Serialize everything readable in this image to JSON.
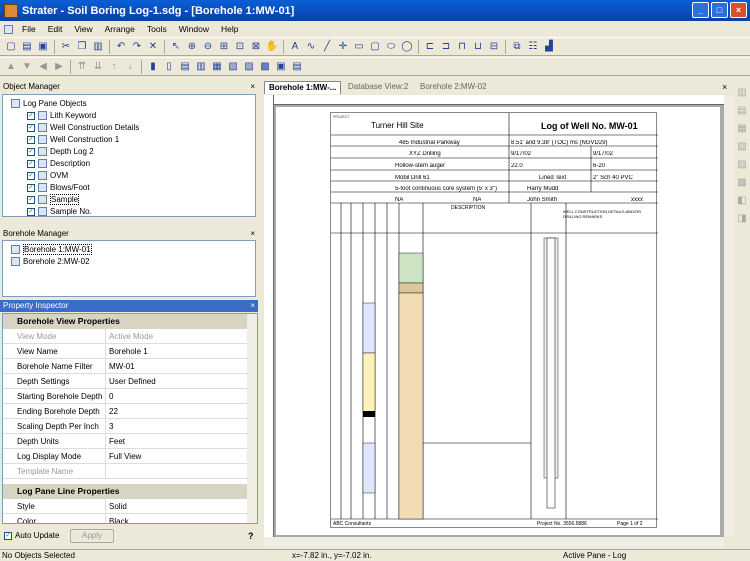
{
  "window": {
    "title": "Strater - Soil Boring Log-1.sdg - [Borehole 1:MW-01]",
    "min": "_",
    "max": "□",
    "close": "×"
  },
  "menu": [
    "File",
    "Edit",
    "View",
    "Arrange",
    "Tools",
    "Window",
    "Help"
  ],
  "object_manager": {
    "title": "Object Manager",
    "items": [
      "Log Pane Objects",
      "Lith Keyword",
      "Well Construction Details",
      "Well Construction 1",
      "Depth Log 2",
      "Description",
      "OVM",
      "Blows/Foot",
      "Sample",
      "Sample No."
    ]
  },
  "borehole_manager": {
    "title": "Borehole Manager",
    "items": [
      "Borehole 1:MW-01",
      "Borehole 2:MW-02"
    ]
  },
  "property_inspector": {
    "title": "Property Inspector",
    "section1": "Borehole View Properties",
    "rows": [
      {
        "k": "View Mode",
        "v": "Active Mode",
        "dim": true
      },
      {
        "k": "View Name",
        "v": "Borehole 1"
      },
      {
        "k": "Borehole Name Filter",
        "v": "MW-01"
      },
      {
        "k": "Depth Settings",
        "v": "User Defined"
      },
      {
        "k": "Starting Borehole Depth",
        "v": "0"
      },
      {
        "k": "Ending Borehole Depth",
        "v": "22"
      },
      {
        "k": "Scaling Depth Per Inch",
        "v": "3"
      },
      {
        "k": "Depth Units",
        "v": "Feet"
      },
      {
        "k": "Log Display Mode",
        "v": "Full View"
      },
      {
        "k": "Template Name",
        "v": "",
        "dim": true
      }
    ],
    "section2": "Log Pane Line Properties",
    "rows2": [
      {
        "k": "Style",
        "v": "Solid"
      },
      {
        "k": "Color",
        "v": "Black"
      }
    ],
    "auto_update": "Auto Update",
    "apply": "Apply",
    "help": "?"
  },
  "tabs": [
    "Borehole 1:MW-...",
    "Database View:2",
    "Borehole 2:MW-02"
  ],
  "log": {
    "client_label": "PROJECT",
    "site": "Turner Hill Site",
    "well": "Log of Well No. MW-01",
    "address": "485 Industrial Parkway",
    "elev": "8.51' and 9.38' (TOC) ms (NGVD29)",
    "contractor": "XYZ Drilling",
    "date1": "9/17/02",
    "date2": "9/17/02",
    "method": "Hollow-stem auger",
    "depth": "22.0",
    "sample": "6-20",
    "equipment": "Mobil Drill 61",
    "type": "Lined Text",
    "well_mat": "2\" Sch 40 PVC",
    "sampling": "5-foot continuous core system (5' x 3\")",
    "logged": "Harry Mudd",
    "hammer": "NA",
    "hammer2": "NA",
    "checked": "John Smith",
    "xxxx": "xxxx",
    "desc_head": "DESCRIPTION",
    "well_head": "WELL CONSTRUCTION DETAILS AND/OR DRILLING REMARKS",
    "footer_left": "ABC Consultants",
    "footer_mid": "Project No. 3556.5886",
    "footer_right": "Page 1 of 2"
  },
  "status": {
    "left": "No Objects Selected",
    "mid": "x=-7.82 in., y=-7.02 in.",
    "right": "Active Pane - Log"
  }
}
